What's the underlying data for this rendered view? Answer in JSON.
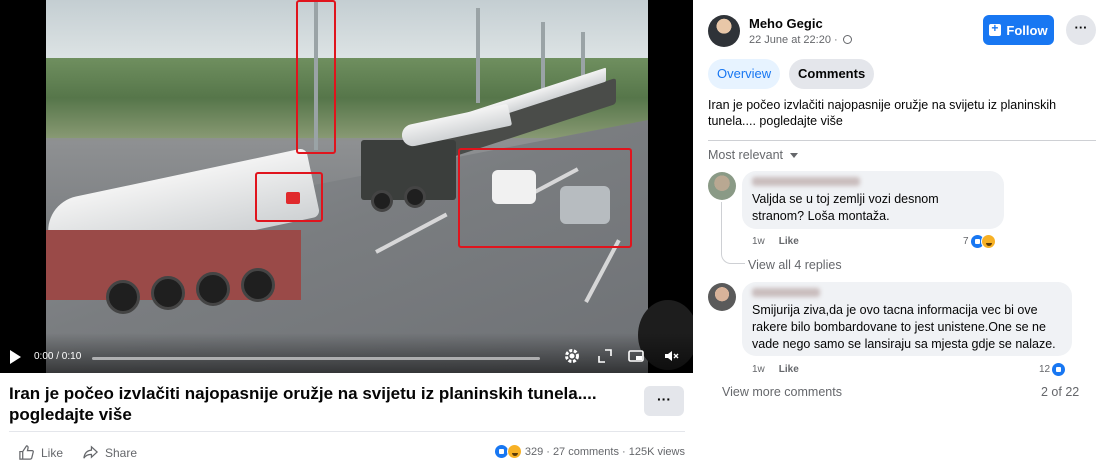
{
  "video": {
    "time": "0:00 / 0:10",
    "progress_fraction": 0.0
  },
  "post": {
    "title": "Iran je počeo izvlačiti najopasnije oružje na svijetu iz planinskih tunela.... pogledajte više",
    "more_label": "···",
    "like_label": "Like",
    "share_label": "Share",
    "reaction_count": "329",
    "stats_rest": "· 27 comments · 125K views"
  },
  "panel": {
    "author": "Meho Gegic",
    "date": "22 June at 22:20 ·",
    "follow_label": "Follow",
    "dots_label": "···",
    "tabs": [
      {
        "label": "Overview"
      },
      {
        "label": "Comments"
      }
    ],
    "description": "Iran je počeo izvlačiti najopasnije oružje na svijetu iz planinskih tunela.... pogledajte više",
    "sort_label": "Most relevant",
    "comments": [
      {
        "text": "Valjda se u toj zemlji vozi desnom stranom? Loša montaža.",
        "time": "1w",
        "like_label": "Like",
        "reaction_count": "7"
      },
      {
        "text": "Smijurija ziva,da je ovo tacna informacija vec bi ove rakere bilo bombardovane to jest unistene.One se ne vade nego samo se lansiraju sa mjesta gdje se nalaze.",
        "time": "1w",
        "like_label": "Like",
        "reaction_count": "12"
      }
    ],
    "view_replies": "View all 4 replies",
    "view_more": "View more comments",
    "page_count": "2 of 22"
  },
  "colors": {
    "accent": "#1877f2",
    "highlight_box": "#e0141d",
    "muted_text": "#65676b"
  },
  "icons": [
    "play-icon",
    "settings-icon",
    "fullscreen-icon",
    "pip-icon",
    "volume-icon",
    "like-icon",
    "share-icon",
    "globe-icon",
    "follow-icon",
    "chevron-down-icon"
  ]
}
